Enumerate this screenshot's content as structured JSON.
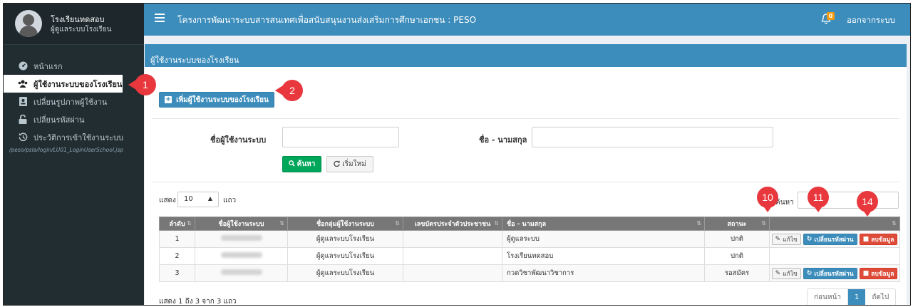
{
  "user": {
    "school": "โรงเรียนทดสอบ",
    "role": "ผู้ดูแลระบบโรงเรียน"
  },
  "menu": {
    "items": [
      {
        "label": "หน้าแรก"
      },
      {
        "label": "ผู้ใช้งานระบบของโรงเรียน"
      },
      {
        "label": "เปลี่ยนรูปภาพผู้ใช้งาน"
      },
      {
        "label": "เปลี่ยนรหัสผ่าน"
      },
      {
        "label": "ประวัติการเข้าใช้งานระบบ"
      }
    ],
    "path": "/peso/psla/login/LU01_LoginUserSchool.jsp"
  },
  "header": {
    "title": "โครงการพัฒนาระบบสารสนเทศเพื่อสนับสนุนงานส่งเสริมการศึกษาเอกชน : PESO",
    "notifications": "0",
    "logout": "ออกจากระบบ"
  },
  "box": {
    "title": "ผู้ใช้งานระบบของโรงเรียน",
    "add_button": "เพิ่มผู้ใช้งานระบบของโรงเรียน"
  },
  "search": {
    "username_label": "ชื่อผู้ใช้งานระบบ",
    "fullname_label": "ชื่อ - นามสกุล",
    "search_button": "ค้นหา",
    "reset_button": "เริ่มใหม่"
  },
  "table_ctrl": {
    "show_label": "แสดง",
    "page_length": "10",
    "unit": "แถว",
    "filter_label": "ค้นหา"
  },
  "table": {
    "headers": [
      "ลำดับ",
      "ชื่อผู้ใช้งานระบบ",
      "ชื่อกลุ่มผู้ใช้งานระบบ",
      "เลขบัตรประจำตัวประชาชน",
      "ชื่อ - นามสกุล",
      "สถานะ",
      ""
    ],
    "rows": [
      {
        "no": "1",
        "group": "ผู้ดูแลระบบโรงเรียน",
        "idcard": "",
        "name": "ผู้ดูแลระบบ",
        "status": "ปกติ",
        "actions": true
      },
      {
        "no": "2",
        "group": "ผู้ดูแลระบบโรงเรียน",
        "idcard": "",
        "name": "โรงเรียนทดสอบ",
        "status": "ปกติ",
        "actions": false
      },
      {
        "no": "3",
        "group": "ผู้ดูแลระบบโรงเรียน",
        "idcard": "",
        "name": "กวดวิชาพัฒนาวิชาการ",
        "status": "รอสมัคร",
        "actions": true
      }
    ],
    "actions": {
      "edit": "แก้ไข",
      "password": "เปลี่ยนรหัสผ่าน",
      "delete": "ลบข้อมูล"
    }
  },
  "footer": {
    "info": "แสดง 1 ถึง 3 จาก 3 แถว",
    "prev": "ก่อนหน้า",
    "page": "1",
    "next": "ถัดไป"
  },
  "markers": [
    "1",
    "2",
    "10",
    "11",
    "14"
  ]
}
